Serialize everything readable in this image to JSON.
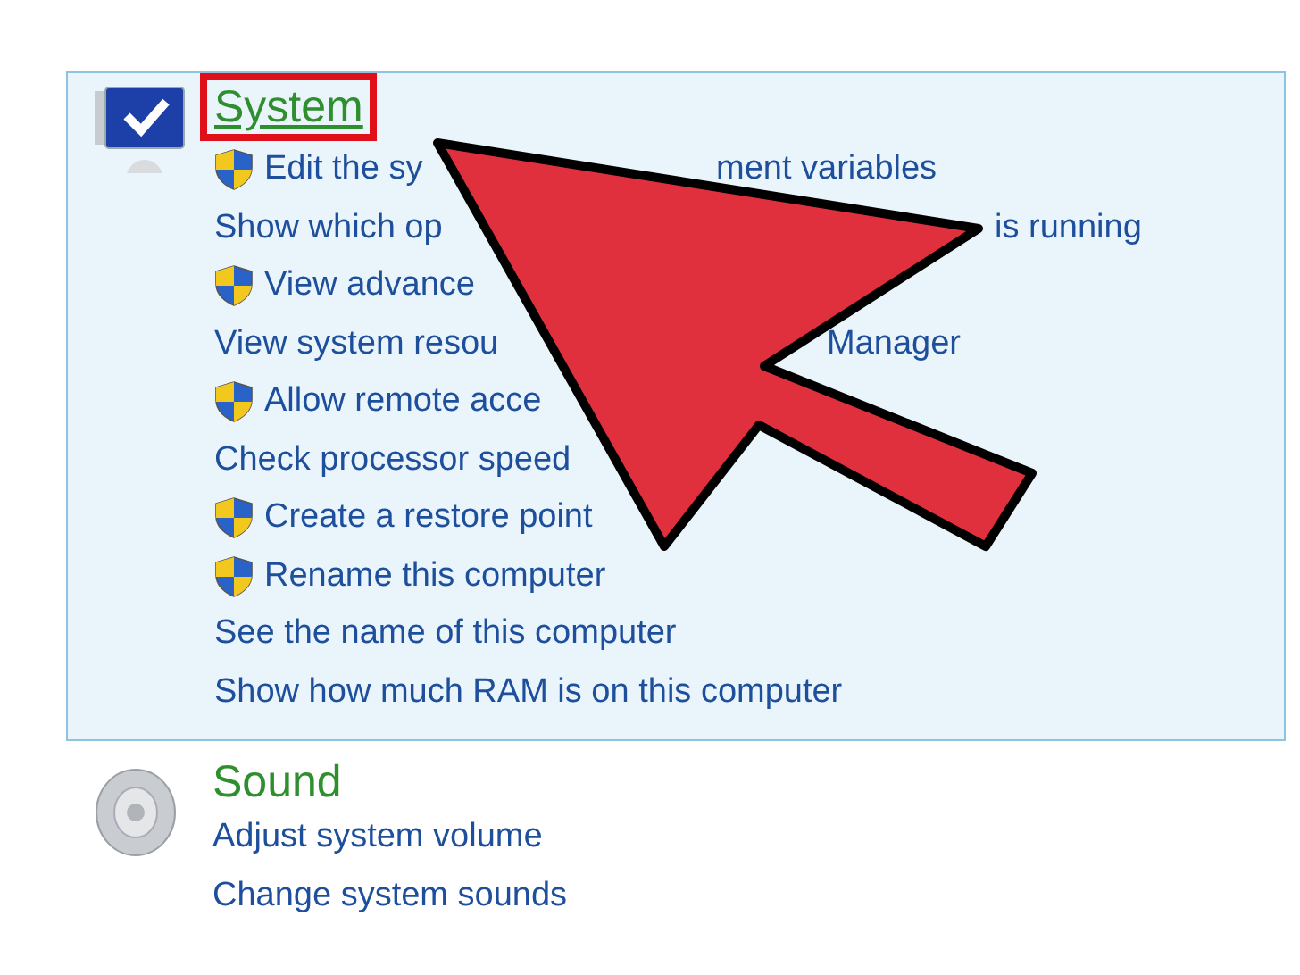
{
  "sections": [
    {
      "title": "System",
      "highlighted": true,
      "selected": true,
      "links": [
        {
          "shield": true,
          "text": "Edit the sy",
          "text_after": "ment variables"
        },
        {
          "shield": false,
          "text": "Show which op",
          "text_after": "is running"
        },
        {
          "shield": true,
          "text": "View advance"
        },
        {
          "shield": false,
          "text": "View system resou",
          "text_after": "Manager"
        },
        {
          "shield": true,
          "text": "Allow remote acce"
        },
        {
          "shield": false,
          "text": "Check processor speed"
        },
        {
          "shield": true,
          "text": "Create a restore point"
        },
        {
          "shield": true,
          "text": "Rename this computer"
        },
        {
          "shield": false,
          "text": "See the name of this computer"
        },
        {
          "shield": false,
          "text": "Show how much RAM is on this computer"
        }
      ]
    },
    {
      "title": "Sound",
      "highlighted": false,
      "selected": false,
      "links": [
        {
          "shield": false,
          "text": "Adjust system volume"
        },
        {
          "shield": false,
          "text": "Change system sounds"
        }
      ]
    }
  ]
}
